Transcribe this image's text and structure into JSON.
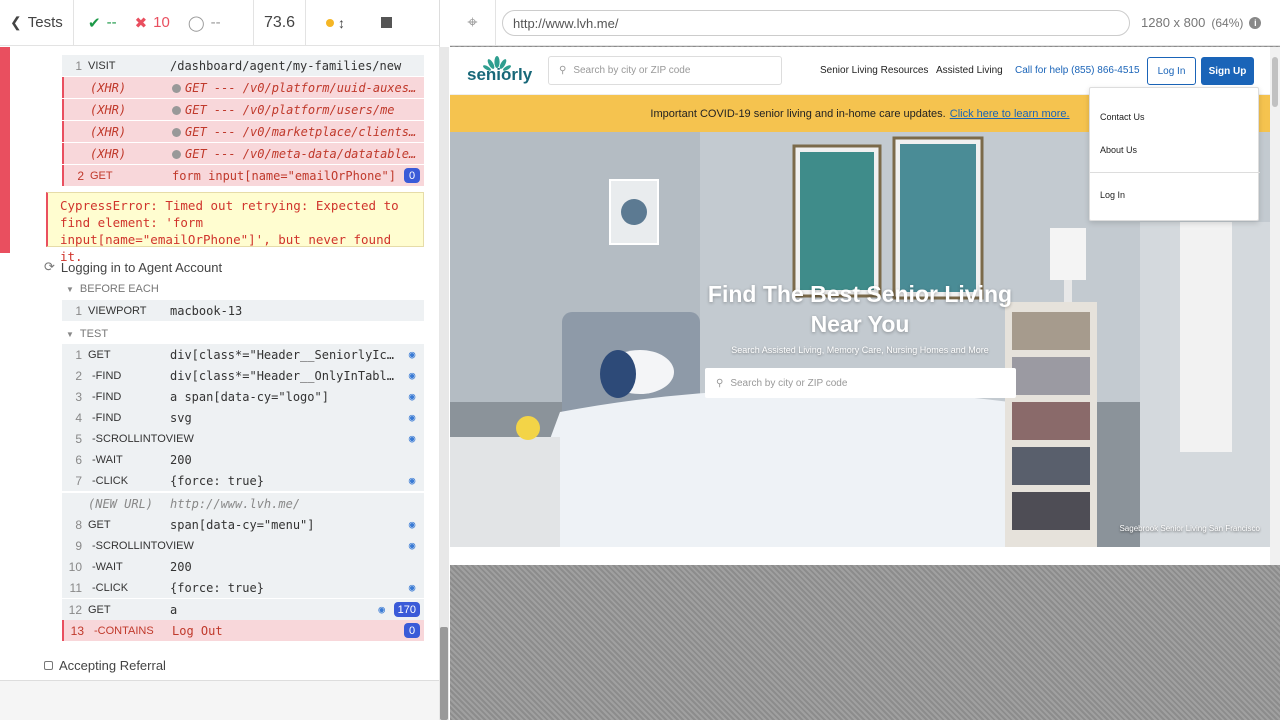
{
  "reporter": {
    "header": {
      "tests_label": "Tests",
      "passed": "--",
      "failed": "10",
      "pending": "--",
      "duration": "73.6"
    },
    "failed_test": {
      "commands": [
        {
          "num": "1",
          "name": "VISIT",
          "msg": "/dashboard/agent/my-families/new"
        },
        {
          "num": "",
          "name": "(XHR)",
          "msg": "GET --- /v0/platform/uuid-auxes…"
        },
        {
          "num": "",
          "name": "(XHR)",
          "msg": "GET --- /v0/platform/users/me"
        },
        {
          "num": "",
          "name": "(XHR)",
          "msg": "GET --- /v0/marketplace/clients…"
        },
        {
          "num": "",
          "name": "(XHR)",
          "msg": "GET --- /v0/meta-data/datatable…"
        },
        {
          "num": "2",
          "name": "GET",
          "msg": "form input[name=\"emailOrPhone\"]",
          "badge": "0"
        }
      ],
      "error": "CypressError: Timed out retrying: Expected to find element: 'form input[name=\"emailOrPhone\"]', but never found it."
    },
    "suite_title": "Logging in to Agent Account",
    "before_each_label": "BEFORE EACH",
    "before_each_commands": [
      {
        "num": "1",
        "name": "VIEWPORT",
        "msg": "macbook-13"
      }
    ],
    "test_label": "TEST",
    "test_commands": [
      {
        "num": "1",
        "name": "GET",
        "msg": "div[class*=\"Header__SeniorlyIc…"
      },
      {
        "num": "2",
        "name": "-FIND",
        "msg": "div[class*=\"Header__OnlyInTabl…"
      },
      {
        "num": "3",
        "name": "-FIND",
        "msg": "a span[data-cy=\"logo\"]"
      },
      {
        "num": "4",
        "name": "-FIND",
        "msg": "svg"
      },
      {
        "num": "5",
        "name": "-SCROLLINTOVIEW",
        "msg": ""
      },
      {
        "num": "6",
        "name": "-WAIT",
        "msg": "200"
      },
      {
        "num": "7",
        "name": "-CLICK",
        "msg": "{force: true}"
      },
      {
        "num": "",
        "name": "(NEW URL)",
        "msg": "http://www.lvh.me/"
      },
      {
        "num": "8",
        "name": "GET",
        "msg": "span[data-cy=\"menu\"]"
      },
      {
        "num": "9",
        "name": "-SCROLLINTOVIEW",
        "msg": ""
      },
      {
        "num": "10",
        "name": "-WAIT",
        "msg": "200"
      },
      {
        "num": "11",
        "name": "-CLICK",
        "msg": "{force: true}"
      },
      {
        "num": "12",
        "name": "GET",
        "msg": "a",
        "badge": "170"
      },
      {
        "num": "13",
        "name": "-CONTAINS",
        "msg": "Log Out",
        "badge": "0"
      }
    ],
    "next_test_title": "Accepting Referral"
  },
  "preview": {
    "url": "http://www.lvh.me/",
    "viewport_size": "1280 x 800",
    "zoom": "(64%)",
    "site": {
      "logo_text": "seniorly",
      "search_placeholder": "Search by city or ZIP code",
      "nav": {
        "resources": "Senior Living Resources",
        "assisted": "Assisted Living",
        "phone": "Call for help (855) 866-4515"
      },
      "login_label": "Log In",
      "signup_label": "Sign Up",
      "banner_text": "Important COVID-19 senior living and in-home care updates.",
      "banner_link": "Click here to learn more.",
      "hero_title": "Find The Best Senior Living Near You",
      "hero_subtitle": "Search Assisted Living, Memory Care, Nursing Homes and More",
      "hero_search_placeholder": "Search by city or ZIP code",
      "hero_caption": "Sagebrook Senior Living San Francisco",
      "menu": {
        "contact": "Contact Us",
        "about": "About Us",
        "login": "Log In"
      }
    }
  },
  "colors": {
    "fail": "#e94f5f",
    "pass": "#1c9947",
    "brand_teal": "#186879",
    "brand_blue": "#1a64b8",
    "banner_yellow": "#f5c34f"
  }
}
